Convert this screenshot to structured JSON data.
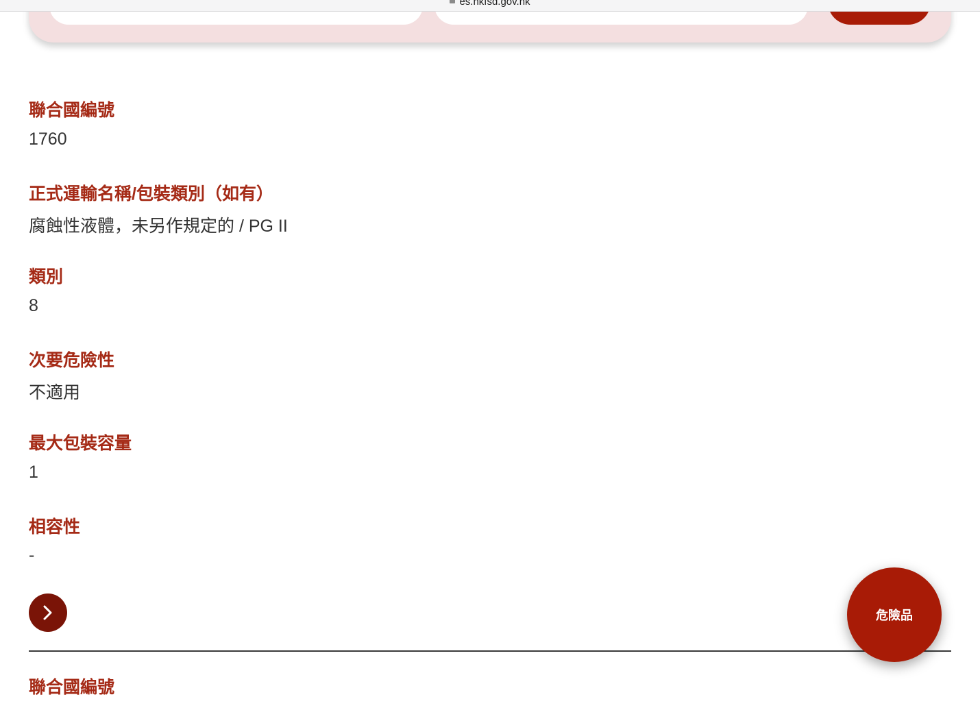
{
  "browser": {
    "url": "es.hkfsd.gov.hk"
  },
  "colors": {
    "accent": "#a81b06",
    "label": "#a52a16",
    "value_text": "#333333",
    "panel_bg": "#f4dfe0",
    "arrow_button": "#7a1407"
  },
  "details": {
    "un_number_label": "聯合國編號",
    "un_number_value": "1760",
    "shipping_name_label": "正式運輸名稱/包裝類別（如有）",
    "shipping_name_value": "腐蝕性液體，未另作規定的 / PG II",
    "class_label": "類別",
    "class_value": "8",
    "subsidiary_risk_label": "次要危險性",
    "subsidiary_risk_value": "不適用",
    "max_quantity_label": "最大包裝容量",
    "max_quantity_value": "1",
    "compatibility_label": "相容性",
    "compatibility_value": "-"
  },
  "next_item": {
    "un_number_label": "聯合國編號"
  },
  "fab": {
    "label": "危險品"
  },
  "icons": {
    "more_button_icon": "chevron-right-icon",
    "url_icon": "lock-icon"
  }
}
